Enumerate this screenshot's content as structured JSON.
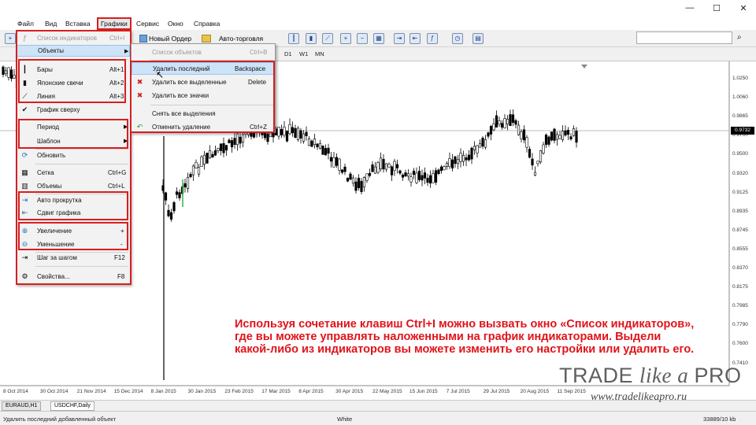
{
  "window": {
    "minimize": "—",
    "maximize": "☐",
    "close": "✕"
  },
  "menubar": {
    "items": [
      "Файл",
      "Вид",
      "Вставка",
      "Графики",
      "Сервис",
      "Окно",
      "Справка"
    ],
    "active": "Графики"
  },
  "toolbar": {
    "new_order": "Новый Ордер",
    "auto_trading": "Авто-торговля"
  },
  "timeframes": [
    "D1",
    "W1",
    "MN"
  ],
  "charts_menu": {
    "items": [
      {
        "label": "Список индикаторов",
        "shortcut": "Ctrl+I",
        "disabled": true
      },
      {
        "label": "Объекты",
        "submenu": true
      },
      {
        "label": "Бары",
        "shortcut": "Alt+1"
      },
      {
        "label": "Японские свечи",
        "shortcut": "Alt+2"
      },
      {
        "label": "Линия",
        "shortcut": "Alt+3"
      },
      {
        "label": "График сверху"
      },
      {
        "label": "Период",
        "submenu": true
      },
      {
        "label": "Шаблон",
        "submenu": true
      },
      {
        "label": "Обновить"
      },
      {
        "label": "Сетка",
        "shortcut": "Ctrl+G"
      },
      {
        "label": "Объемы",
        "shortcut": "Ctrl+L"
      },
      {
        "label": "Авто прокрутка"
      },
      {
        "label": "Сдвиг графика"
      },
      {
        "label": "Увеличение",
        "shortcut": "+"
      },
      {
        "label": "Уменьшение",
        "shortcut": "-"
      },
      {
        "label": "Шаг за шагом",
        "shortcut": "F12"
      },
      {
        "label": "Свойства...",
        "shortcut": "F8"
      }
    ]
  },
  "objects_menu": {
    "items": [
      {
        "label": "Список объектов",
        "shortcut": "Ctrl+B",
        "disabled": true
      },
      {
        "label": "Удалить последний",
        "shortcut": "Backspace",
        "highlighted": true
      },
      {
        "label": "Удалить все выделенные",
        "shortcut": "Delete"
      },
      {
        "label": "Удалить все значки"
      },
      {
        "label": "Снять все выделения"
      },
      {
        "label": "Отменить удаление",
        "shortcut": "Ctrl+Z"
      }
    ]
  },
  "chart": {
    "current_price": "0.9732",
    "price_ticks": [
      "1.0250",
      "1.0060",
      "0.9865",
      "0.9700",
      "0.9500",
      "0.9320",
      "0.9125",
      "0.8935",
      "0.8745",
      "0.8555",
      "0.8370",
      "0.8175",
      "0.7985",
      "0.7790",
      "0.7600",
      "0.7410"
    ],
    "date_ticks": [
      "8 Oct 2014",
      "30 Oct 2014",
      "21 Nov 2014",
      "15 Dec 2014",
      "8 Jan 2015",
      "30 Jan 2015",
      "23 Feb 2015",
      "17 Mar 2015",
      "8 Apr 2015",
      "30 Apr 2015",
      "22 May 2015",
      "15 Jun 2015",
      "7 Jul 2015",
      "29 Jul 2015",
      "20 Aug 2015",
      "11 Sep 2015"
    ]
  },
  "tabs": [
    "EURAUD,H1",
    "USDCHF,Daily"
  ],
  "active_tab": "USDCHF,Daily",
  "status": {
    "message": "Удалить последний добавленный объект",
    "profile": "White",
    "traffic": "33889/10 kb"
  },
  "caption": {
    "line1": "Используя сочетание клавиш Ctrl+I можно вызвать окно «Список индикаторов»,",
    "line2": "где вы можете управлять наложенными на график индикаторами. Выдели",
    "line3": "какой-либо из индикаторов вы можете изменить его настройки или удалить его."
  },
  "brand": {
    "trade": "TRADE ",
    "like_a": "like a ",
    "pro": "PRO",
    "url": "www.tradelikeapro.ru"
  },
  "colors": {
    "highlight": "#d81e1e",
    "caption": "#e0131a",
    "menu_highlight": "#cde3f7"
  }
}
